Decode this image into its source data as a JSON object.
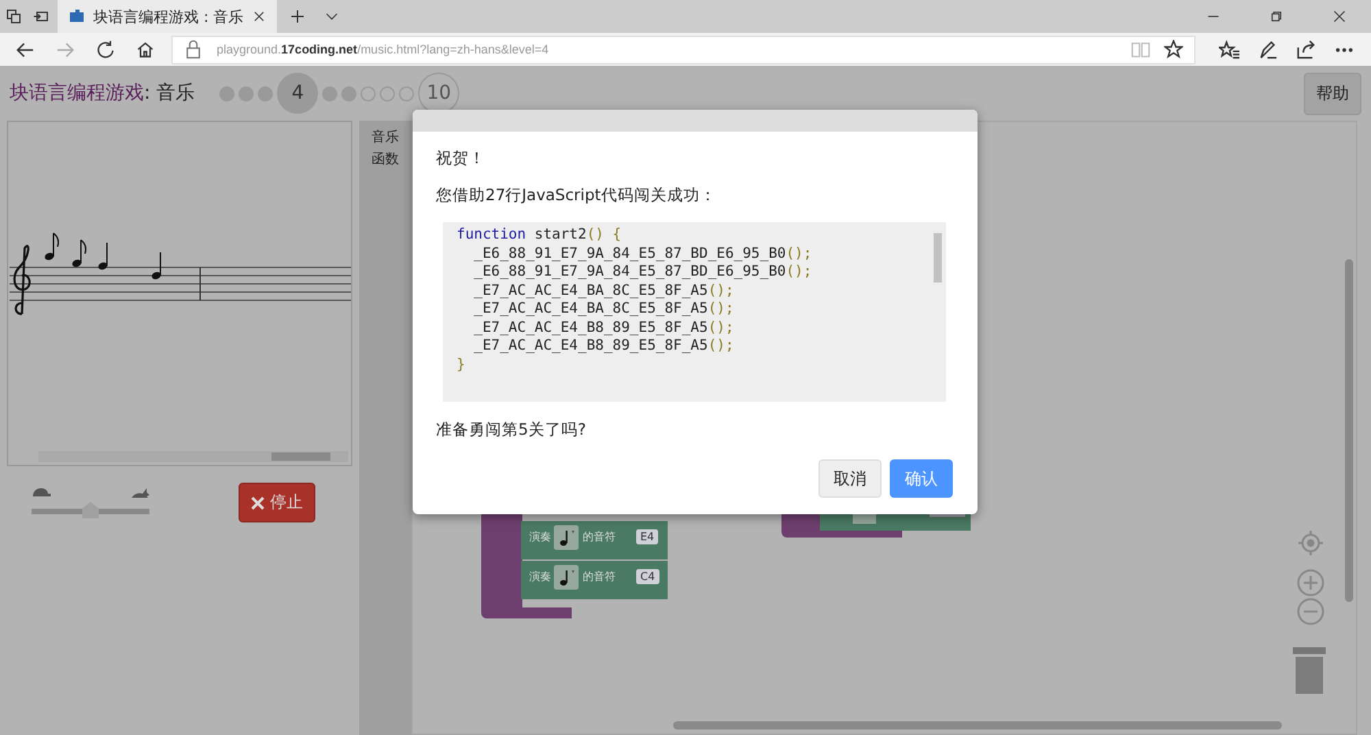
{
  "browser": {
    "tab_title": "块语言编程游戏 : 音乐",
    "url": "playground.**17coding.net**/music.html?lang=zh-hans&level=4"
  },
  "header": {
    "title": "块语言编程游戏",
    "subtitle": " : 音乐",
    "levels": [
      {
        "kind": "done"
      },
      {
        "kind": "done"
      },
      {
        "kind": "done"
      },
      {
        "kind": "current",
        "label": "4"
      },
      {
        "kind": "done"
      },
      {
        "kind": "done"
      },
      {
        "kind": "todo"
      },
      {
        "kind": "todo"
      },
      {
        "kind": "todo"
      },
      {
        "kind": "todo",
        "label": "10"
      }
    ],
    "help_button": "帮助"
  },
  "controls": {
    "speed": {
      "level": 0.5
    },
    "stop_button": "停止"
  },
  "toolbox": {
    "categories": [
      "音乐",
      "函数"
    ]
  },
  "workspace": {
    "blocks": [
      {
        "label": "演奏",
        "middle": "的音符",
        "value": "E4"
      },
      {
        "label": "演奏",
        "middle": "的音符",
        "value": "C4"
      }
    ]
  },
  "dialog": {
    "title": "祝贺！",
    "message": "您借助27行JavaScript代码闯关成功：",
    "code": [
      [
        {
          "t": "function",
          "kind": "keyword"
        },
        {
          "t": " start2",
          "kind": "name"
        },
        {
          "t": "() {",
          "kind": "punct"
        }
      ],
      [
        {
          "t": "  _E6_88_91_E7_9A_84_E5_87_BD_E6_95_B0",
          "kind": "name"
        },
        {
          "t": "();",
          "kind": "punct"
        }
      ],
      [
        {
          "t": "  _E6_88_91_E7_9A_84_E5_87_BD_E6_95_B0",
          "kind": "name"
        },
        {
          "t": "();",
          "kind": "punct"
        }
      ],
      [
        {
          "t": "  _E7_AC_AC_E4_BA_8C_E5_8F_A5",
          "kind": "name"
        },
        {
          "t": "();",
          "kind": "punct"
        }
      ],
      [
        {
          "t": "  _E7_AC_AC_E4_BA_8C_E5_8F_A5",
          "kind": "name"
        },
        {
          "t": "();",
          "kind": "punct"
        }
      ],
      [
        {
          "t": "  _E7_AC_AC_E4_B8_89_E5_8F_A5",
          "kind": "name"
        },
        {
          "t": "();",
          "kind": "punct"
        }
      ],
      [
        {
          "t": "  _E7_AC_AC_E4_B8_89_E5_8F_A5",
          "kind": "name"
        },
        {
          "t": "();",
          "kind": "punct"
        }
      ],
      [
        {
          "t": "}",
          "kind": "punct"
        }
      ]
    ],
    "question": "准备勇闯第5关了吗?",
    "buttons": [
      {
        "label": "取消",
        "kind": "secondary"
      },
      {
        "label": "确认",
        "kind": "primary"
      }
    ]
  }
}
